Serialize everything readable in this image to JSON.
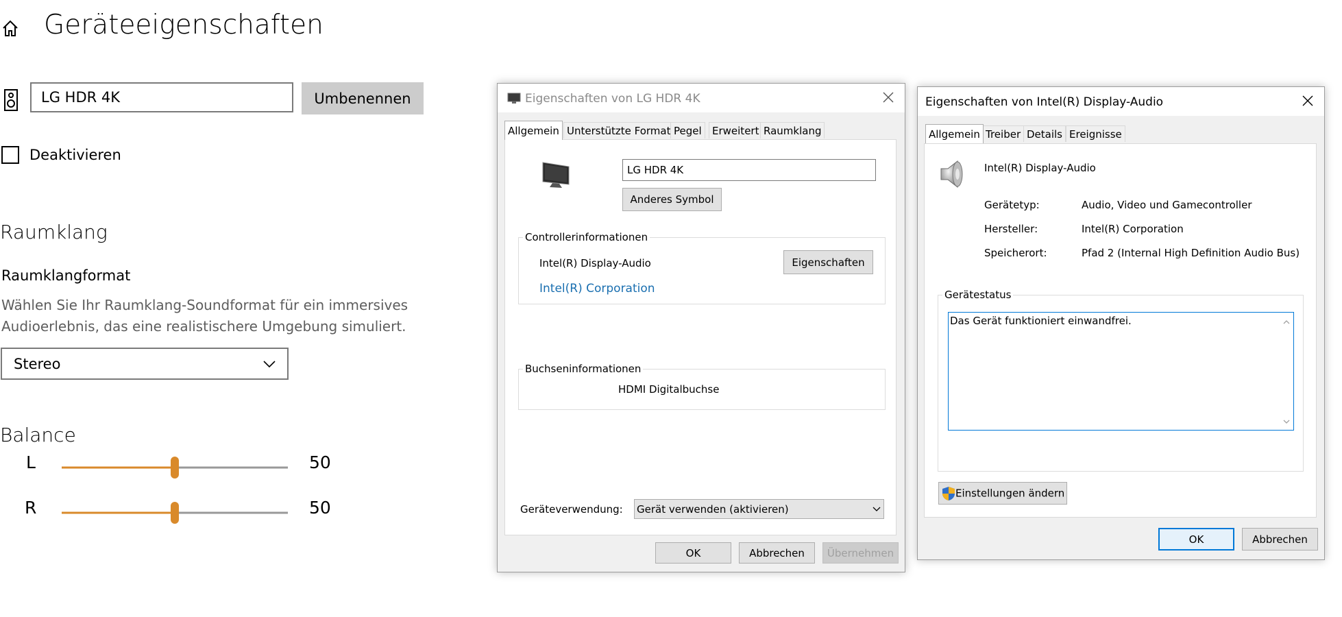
{
  "settings": {
    "title": "Geräteeigenschaften",
    "device_name_value": "LG HDR 4K",
    "rename_label": "Umbenennen",
    "disable_label": "Deaktivieren",
    "raumklang_heading": "Raumklang",
    "raumklang_format_label": "Raumklangformat",
    "raumklang_format_desc": "Wählen Sie Ihr Raumklang-Soundformat für ein immersives Audioerlebnis, das eine realistischere Umgebung simuliert.",
    "raumklang_format_value": "Stereo",
    "balance_heading": "Balance",
    "balance_left_label": "L",
    "balance_left_value": "50",
    "balance_right_label": "R",
    "balance_right_value": "50",
    "accent_color": "#d98a2b"
  },
  "dialog_lg": {
    "title": "Eigenschaften von LG HDR 4K",
    "tabs": [
      "Allgemein",
      "Unterstützte Formate",
      "Pegel",
      "Erweitert",
      "Raumklang"
    ],
    "device_name_value": "LG HDR 4K",
    "change_icon_label": "Anderes Symbol",
    "controller_group": "Controllerinformationen",
    "controller_name": "Intel(R) Display-Audio",
    "controller_vendor": "Intel(R) Corporation",
    "properties_label": "Eigenschaften",
    "jack_group": "Buchseninformationen",
    "jack_value": "HDMI Digitalbuchse",
    "usage_label": "Geräteverwendung:",
    "usage_value": "Gerät verwenden (aktivieren)",
    "ok_label": "OK",
    "cancel_label": "Abbrechen",
    "apply_label": "Übernehmen"
  },
  "dialog_intel": {
    "title": "Eigenschaften von Intel(R) Display-Audio",
    "tabs": [
      "Allgemein",
      "Treiber",
      "Details",
      "Ereignisse"
    ],
    "device_name": "Intel(R) Display-Audio",
    "type_label": "Gerätetyp:",
    "type_value": "Audio, Video und Gamecontroller",
    "vendor_label": "Hersteller:",
    "vendor_value": "Intel(R) Corporation",
    "location_label": "Speicherort:",
    "location_value": "Pfad 2 (Internal High Definition Audio Bus)",
    "status_group": "Gerätestatus",
    "status_text": "Das Gerät funktioniert einwandfrei.",
    "change_settings_label": "Einstellungen ändern",
    "ok_label": "OK",
    "cancel_label": "Abbrechen"
  }
}
